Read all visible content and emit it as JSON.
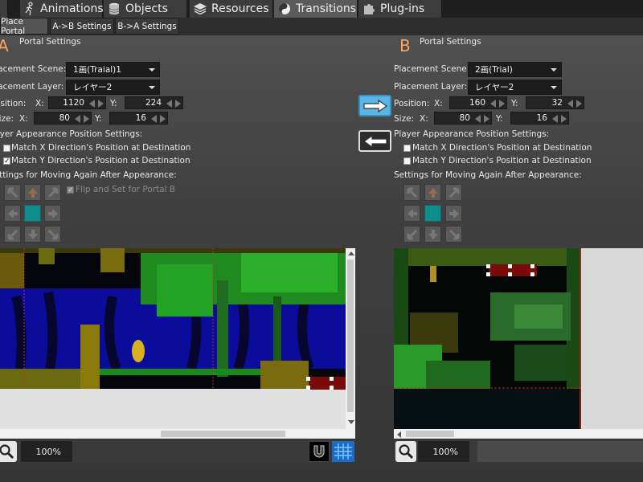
{
  "top_tabs": [
    {
      "label": "Animations",
      "icon": "running-figure-icon"
    },
    {
      "label": "Objects",
      "icon": "cylinder-icon"
    },
    {
      "label": "Resources",
      "icon": "layers-icon"
    },
    {
      "label": "Transitions",
      "icon": "transition-icon"
    },
    {
      "label": "Plug-ins",
      "icon": "puzzle-icon"
    }
  ],
  "sub_tabs": [
    "Place Portal",
    "A->B Settings",
    "B->A Settings"
  ],
  "panel_a": {
    "letter": "A",
    "title": "Portal Settings",
    "scene_label": "Placement Scene:",
    "scene_value": "1画(Traial)1",
    "layer_label": "Placement Layer:",
    "layer_value": "レイヤー2",
    "position_label": "Position:",
    "x_label": "X:",
    "y_label": "Y:",
    "pos_x": "1120",
    "pos_y": "224",
    "size_label": "Size:",
    "size_x": "80",
    "size_y": "16",
    "appearance_label": "Player Appearance Position Settings:",
    "match_x_label": "Match X Direction's Position at Destination",
    "match_x": false,
    "match_y_label": "Match Y Direction's Position at Destination",
    "match_y": true,
    "moving_label": "Settings for Moving Again After Appearance:",
    "flip_label": "Flip and Set for Portal B",
    "flip": true,
    "zoom": "100%"
  },
  "panel_b": {
    "letter": "B",
    "title": "Portal Settings",
    "scene_label": "Placement Scene:",
    "scene_value": "2画(Trial)",
    "layer_label": "Placement Layer:",
    "layer_value": "レイヤー2",
    "position_label": "Position:",
    "x_label": "X:",
    "y_label": "Y:",
    "pos_x": "160",
    "pos_y": "32",
    "size_label": "Size:",
    "size_x": "80",
    "size_y": "16",
    "appearance_label": "Player Appearance Position Settings:",
    "match_x_label": "Match X Direction's Position at Destination",
    "match_x": false,
    "match_y_label": "Match Y Direction's Position at Destination",
    "match_y": false,
    "moving_label": "Settings for Moving Again After Appearance:",
    "zoom": "100%"
  },
  "colors": {
    "accent_letter": "#ffa25a",
    "arrow_active": "#5ab4e6",
    "teal": "#0d8c8c"
  }
}
